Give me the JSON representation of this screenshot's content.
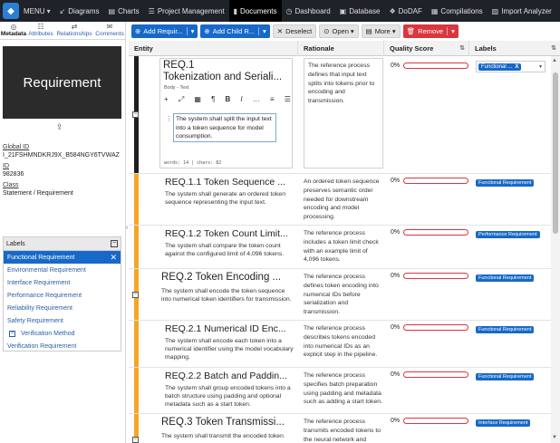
{
  "nav": {
    "logo": "◆",
    "menu": "MENU",
    "items": [
      {
        "label": "Diagrams",
        "icon": "↙"
      },
      {
        "label": "Charts",
        "icon": "▤"
      },
      {
        "label": "Project Management",
        "icon": "☰"
      },
      {
        "label": "Documents",
        "icon": "▮"
      },
      {
        "label": "Dashboard",
        "icon": "◷"
      },
      {
        "label": "Database",
        "icon": "▣"
      },
      {
        "label": "DoDAF",
        "icon": "❖"
      },
      {
        "label": "Compilations",
        "icon": "▦"
      },
      {
        "label": "Import Analyzer",
        "icon": "▨"
      }
    ]
  },
  "left": {
    "tabs": [
      {
        "label": "Metadata",
        "icon": "◎"
      },
      {
        "label": "Attributes",
        "icon": "☷"
      },
      {
        "label": "Relationships",
        "icon": "⇄"
      },
      {
        "label": "Comments",
        "icon": "✉"
      }
    ],
    "preview_title": "Requirement",
    "export_icon": "⇪",
    "global_id_label": "Global ID",
    "global_id": "I_21FSHMNDKRJ9X_B584NGY6TVWAZ",
    "id_label": "ID",
    "id": "982836",
    "class_label": "Class",
    "class": "Statement / Requirement",
    "labels_title": "Labels",
    "labels": [
      "Functional Requirement",
      "Environmental Requirement",
      "Interface Requirement",
      "Performance Requirement",
      "Reliability Requirement",
      "Safety Requirement",
      "Verification Method",
      "Verification Requirement"
    ]
  },
  "toolbar": {
    "add_req": "Add Requir...",
    "add_child": "Add Child R...",
    "deselect": "Deselect",
    "open": "Open",
    "more": "More",
    "remove": "Remove"
  },
  "grid": {
    "headers": [
      "Entity",
      "Rationale",
      "Quality Score",
      "Labels"
    ],
    "editing": {
      "title_line1": "REQ.1",
      "title_line2": "Tokenization and Seriali...",
      "body_label": "Body - Text",
      "text": "The system shall split the input text into a token sequence for model consumption.",
      "count": "words: 14  |  chars: 82",
      "rationale": "The reference process defines that input text splits into tokens prior to encoding and transmission.",
      "quality": "0%",
      "label": "Functional ...",
      "toolbar_icons": [
        "+",
        "⤢",
        "▦",
        "¶",
        "B",
        "I",
        "…",
        "≡",
        "☰"
      ]
    },
    "rows": [
      {
        "title": "REQ.1.1 Token Sequence ...",
        "desc": "The system shall generate an ordered token sequence representing the input text.",
        "rationale": "An ordered token sequence preserves semantic order needed for downstream encoding and model processing.",
        "quality": "0%",
        "label": "Functional Requirement"
      },
      {
        "title": "REQ.1.2 Token Count Limit...",
        "desc": "The system shall compare the token count against the configured limit of 4,096 tokens.",
        "rationale": "The reference process includes a token limit check with an example limit of 4,096 tokens.",
        "quality": "0%",
        "label": "Performance Requirement"
      },
      {
        "title": "REQ.2 Token Encoding ...",
        "desc": "The system shall encode the token sequence into numerical token identifiers for transmission.",
        "rationale": "The reference process defines token encoding into numerical IDs before serialization and transmission.",
        "quality": "0%",
        "label": "Functional Requirement"
      },
      {
        "title": "REQ.2.1 Numerical ID Enc...",
        "desc": "The system shall encode each token into a numerical identifier using the model vocabulary mapping.",
        "rationale": "The reference process describes tokens encoded into numerical IDs as an explicit step in the pipeline.",
        "quality": "0%",
        "label": "Functional Requirement"
      },
      {
        "title": "REQ.2.2 Batch and Paddin...",
        "desc": "The system shall group encoded tokens into a batch structure using padding and optional metadata such as a start token.",
        "rationale": "The reference process specifies batch preparation using padding and metadata such as adding a start token.",
        "quality": "0%",
        "label": "Functional Requirement"
      },
      {
        "title": "REQ.3 Token Transmissi...",
        "desc": "The system shall transmit the encoded token",
        "rationale": "The reference process transmits encoded tokens to the neural network and",
        "quality": "0%",
        "label": "Interface Requirement"
      }
    ]
  }
}
